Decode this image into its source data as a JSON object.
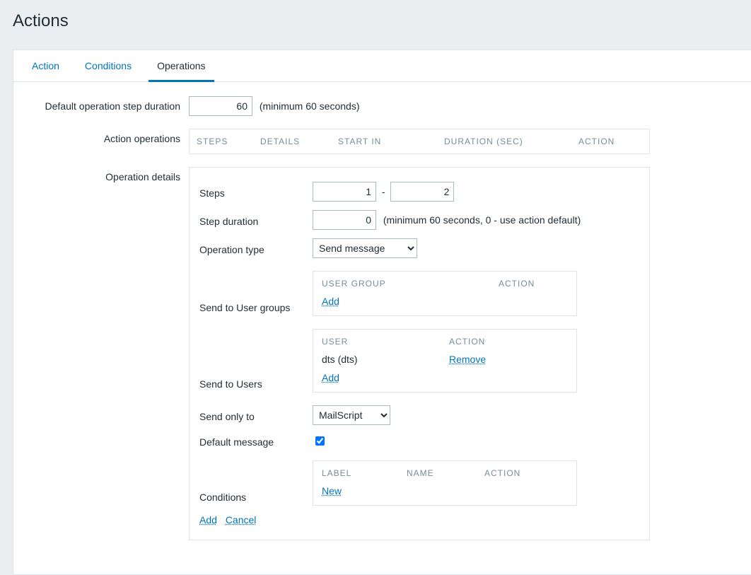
{
  "page": {
    "title": "Actions"
  },
  "tabs": {
    "action": "Action",
    "conditions": "Conditions",
    "operations": "Operations",
    "active": "operations"
  },
  "labels": {
    "default_step_duration": "Default operation step duration",
    "default_step_hint": "(minimum 60 seconds)",
    "action_operations": "Action operations",
    "operation_details": "Operation details",
    "steps": "Steps",
    "step_duration": "Step duration",
    "step_duration_hint": "(minimum 60 seconds, 0 - use action default)",
    "operation_type": "Operation type",
    "send_to_user_groups": "Send to User groups",
    "send_to_users": "Send to Users",
    "send_only_to": "Send only to",
    "default_message": "Default message",
    "conditions": "Conditions"
  },
  "ops_columns": {
    "steps": "STEPS",
    "details": "DETAILS",
    "start_in": "START IN",
    "duration": "DURATION (SEC)",
    "action": "ACTION"
  },
  "values": {
    "default_step_duration": "60",
    "step_from": "1",
    "step_to": "2",
    "step_duration": "0",
    "operation_type_selected": "Send message",
    "send_only_to_selected": "MailScript",
    "default_message_checked": true
  },
  "user_group_table": {
    "col_group": "USER GROUP",
    "col_action": "ACTION",
    "add": "Add"
  },
  "user_table": {
    "col_user": "USER",
    "col_action": "ACTION",
    "row_user": "dts (dts)",
    "row_action": "Remove",
    "add": "Add"
  },
  "conditions_table": {
    "col_label": "LABEL",
    "col_name": "NAME",
    "col_action": "ACTION",
    "new": "New"
  },
  "footer": {
    "add": "Add",
    "cancel": "Cancel"
  }
}
